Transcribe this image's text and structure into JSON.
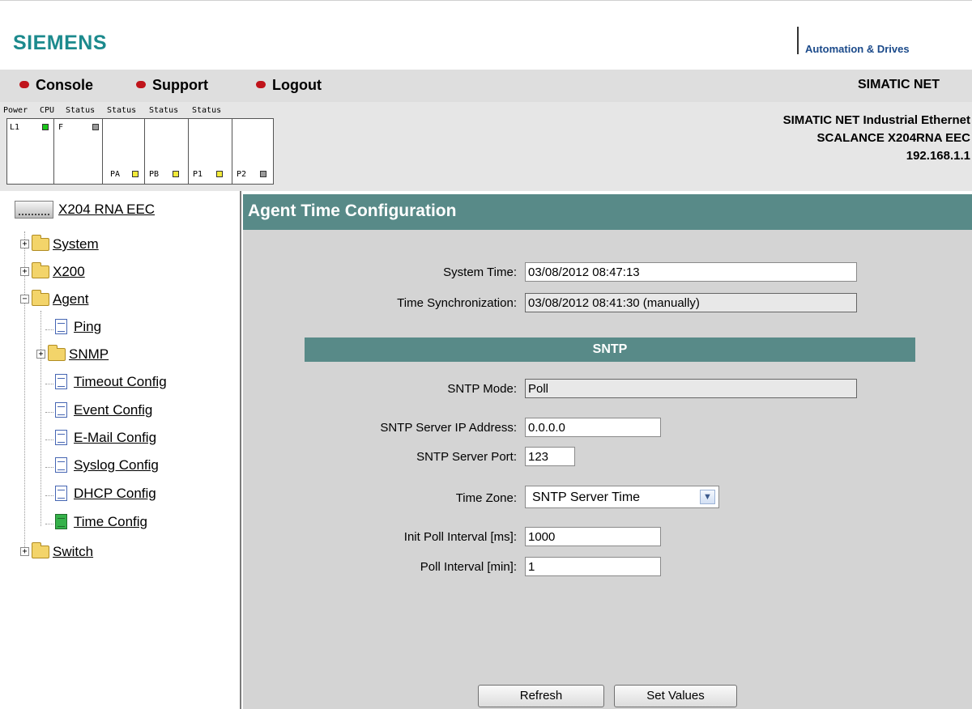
{
  "header": {
    "logo": "SIEMENS",
    "brand": "Automation & Drives",
    "product_line": "SIMATIC NET"
  },
  "nav": {
    "items": [
      {
        "label": "Console"
      },
      {
        "label": "Support"
      },
      {
        "label": "Logout"
      }
    ]
  },
  "status": {
    "labels": [
      "Power",
      "CPU",
      "Status",
      "Status",
      "Status",
      "Status"
    ],
    "power_led": "L1",
    "cpu_led": "F",
    "ports": [
      "PA",
      "PB",
      "P1",
      "P2"
    ],
    "colors": {
      "power": "#19c519",
      "cpu": "#9a9a9a",
      "port": "#f2ea3a",
      "p2": "#9a9a9a"
    },
    "device_line1": "SIMATIC NET Industrial Ethernet",
    "device_line2": "SCALANCE X204RNA EEC",
    "ip": "192.168.1.1"
  },
  "tree": {
    "root": "X204 RNA EEC",
    "items": {
      "system": "System",
      "x200": "X200",
      "agent": "Agent",
      "ping": "Ping",
      "snmp": "SNMP",
      "timeout": "Timeout Config",
      "event": "Event Config",
      "email": "E-Mail Config",
      "syslog": "Syslog Config",
      "dhcp": "DHCP Config",
      "time": "Time Config",
      "switch": "Switch"
    }
  },
  "main": {
    "title": "Agent Time Configuration",
    "system_time_label": "System Time:",
    "system_time_value": "03/08/2012 08:47:13",
    "time_sync_label": "Time Synchronization:",
    "time_sync_value": "03/08/2012 08:41:30 (manually)",
    "sntp_section": "SNTP",
    "sntp_mode_label": "SNTP Mode:",
    "sntp_mode_value": "Poll",
    "sntp_ip_label": "SNTP Server IP Address:",
    "sntp_ip_value": "0.0.0.0",
    "sntp_port_label": "SNTP Server Port:",
    "sntp_port_value": "123",
    "time_zone_label": "Time Zone:",
    "time_zone_value": "SNTP Server Time",
    "init_poll_label": "Init Poll Interval [ms]:",
    "init_poll_value": "1000",
    "poll_label": "Poll Interval [min]:",
    "poll_value": "1",
    "refresh_button": "Refresh",
    "set_values_button": "Set Values"
  },
  "theme": {
    "accent": "#588a88",
    "logo_color": "#1c8a8d",
    "nav_dot": "#c0141b"
  }
}
